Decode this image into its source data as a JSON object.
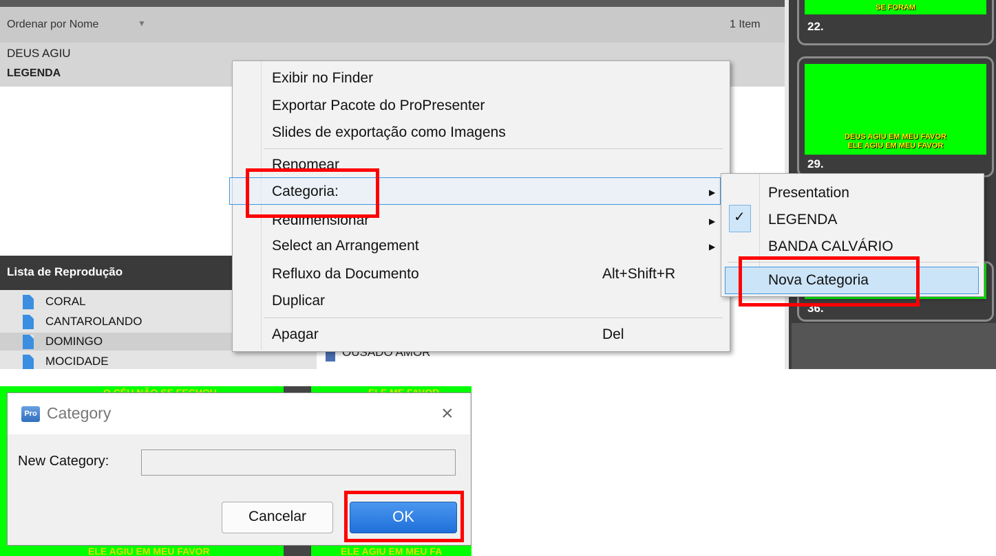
{
  "library": {
    "sort_label": "Ordenar por Nome",
    "item_count": "1 Item",
    "document": {
      "title": "DEUS AGIU",
      "category": "LEGENDA"
    }
  },
  "playlist": {
    "title": "Lista de Reprodução",
    "items": [
      {
        "label": "CORAL"
      },
      {
        "label": "CANTAROLANDO"
      },
      {
        "label": "DOMINGO"
      },
      {
        "label": "MOCIDADE"
      }
    ],
    "behind_item": "OUSADO AMOR"
  },
  "slides": [
    {
      "number": "22.",
      "text": "SE FORAM"
    },
    {
      "number": "29.",
      "text_line1": "DEUS AGIU EM MEU FAVOR",
      "text_line2": "ELE AGIU EM MEU FAVOR"
    },
    {
      "number": "36."
    }
  ],
  "context_menu": {
    "items": [
      {
        "label": "Exibir no Finder"
      },
      {
        "label": "Exportar Pacote do ProPresenter"
      },
      {
        "label": "Slides de exportação como Imagens"
      },
      {
        "label": "Renomear"
      },
      {
        "label": "Categoria:"
      },
      {
        "label": "Redimensionar"
      },
      {
        "label": "Select an Arrangement"
      },
      {
        "label": "Refluxo da Documento",
        "shortcut": "Alt+Shift+R"
      },
      {
        "label": "Duplicar"
      },
      {
        "label": "Apagar",
        "shortcut": "Del"
      }
    ]
  },
  "submenu": {
    "items": [
      {
        "label": "Presentation"
      },
      {
        "label": "LEGENDA",
        "checked": true
      },
      {
        "label": "BANDA CALVÁRIO"
      },
      {
        "label": "Nova Categoria"
      }
    ]
  },
  "dialog": {
    "title": "Category",
    "app_icon_text": "Pro",
    "field_label": "New Category:",
    "field_value": "",
    "cancel_label": "Cancelar",
    "ok_label": "OK",
    "bg_caption_top_left": "O CÉU NÃO SE FECHOU",
    "bg_caption_top_right": "ELE ME FAVOR",
    "bg_caption_bottom_left": "ELE AGIU EM MEU FAVOR",
    "bg_caption_bottom_right": "ELE AGIU EM MEU FA"
  },
  "colors": {
    "accent": "#1f6fd8",
    "highlight": "#ff0000",
    "slide_bg": "#00ff00",
    "slide_text": "#ffff00"
  }
}
